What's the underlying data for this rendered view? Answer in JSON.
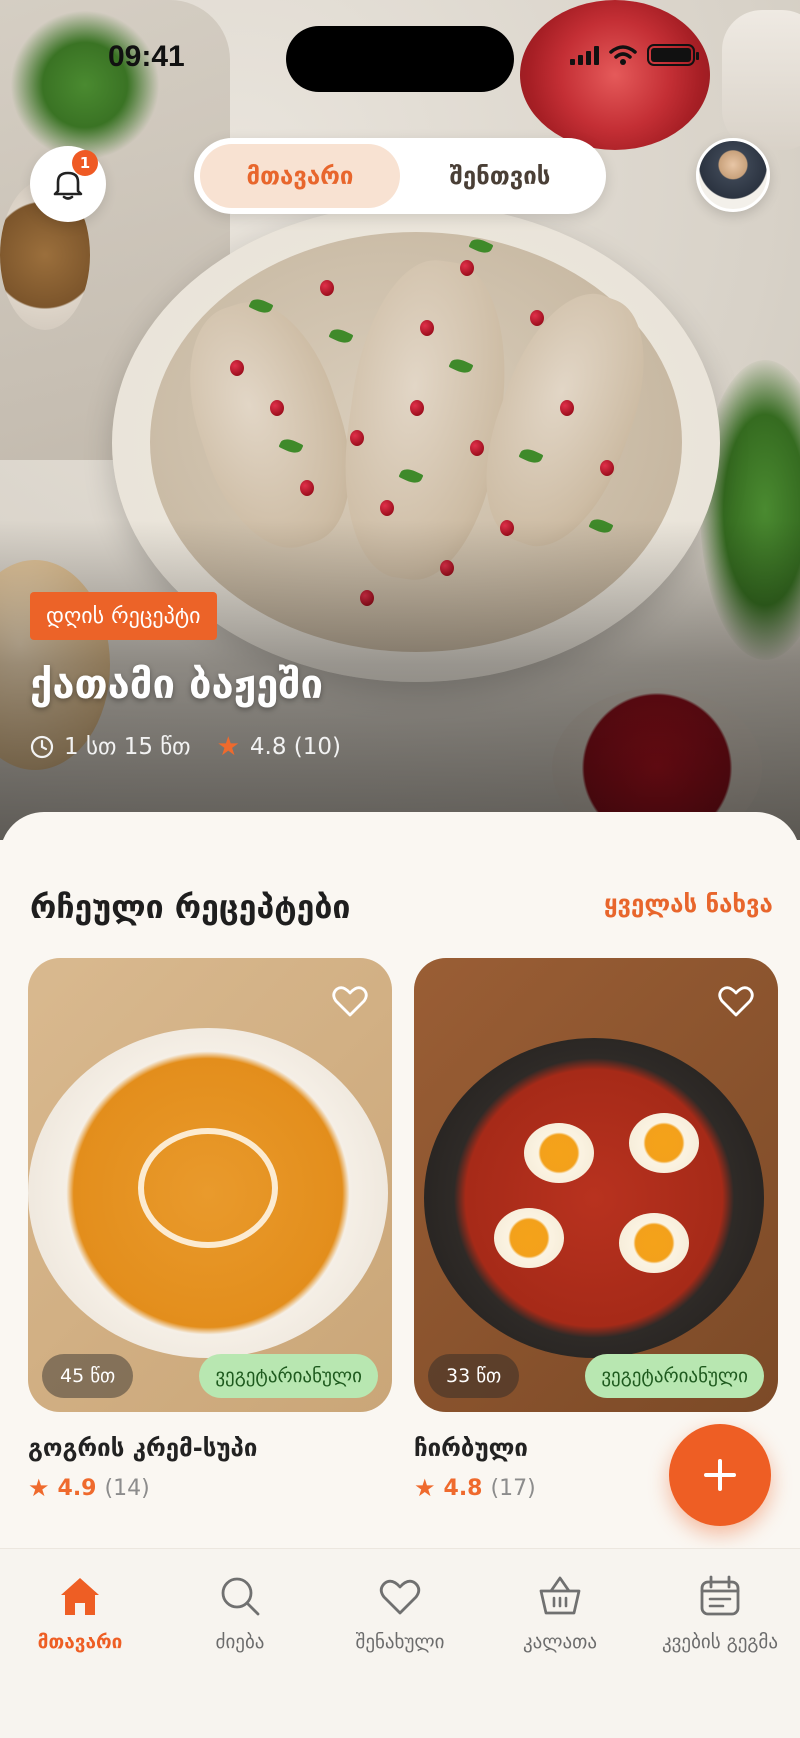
{
  "status_bar": {
    "time": "09:41"
  },
  "header": {
    "notification_count": "1",
    "tabs": [
      {
        "label": "მთავარი",
        "active": true
      },
      {
        "label": "შენთვის",
        "active": false
      }
    ]
  },
  "hero": {
    "tag": "დღის რეცეპტი",
    "title": "ქათამი ბაჟეში",
    "time": "1 სთ 15 წთ",
    "rating": "4.8 (10)"
  },
  "section": {
    "title": "რჩეული რეცეპტები",
    "see_all": "ყველას ნახვა"
  },
  "recipes": [
    {
      "name": "გოგრის კრემ-სუპი",
      "time": "45 წთ",
      "tag": "ვეგეტარიანული",
      "rating": "4.9",
      "count": "(14)"
    },
    {
      "name": "ჩირბული",
      "time": "33 წთ",
      "tag": "ვეგეტარიანული",
      "rating": "4.8",
      "count": "(17)"
    }
  ],
  "tabbar": [
    {
      "label": "მთავარი",
      "icon": "home-icon",
      "active": true
    },
    {
      "label": "ძიება",
      "icon": "search-icon",
      "active": false
    },
    {
      "label": "შენახული",
      "icon": "heart-icon",
      "active": false
    },
    {
      "label": "კალათა",
      "icon": "basket-icon",
      "active": false
    },
    {
      "label": "კვების გეგმა",
      "icon": "calendar-icon",
      "active": false
    }
  ],
  "colors": {
    "accent": "#ee5e24",
    "veg_badge": "#b8e7b1"
  }
}
